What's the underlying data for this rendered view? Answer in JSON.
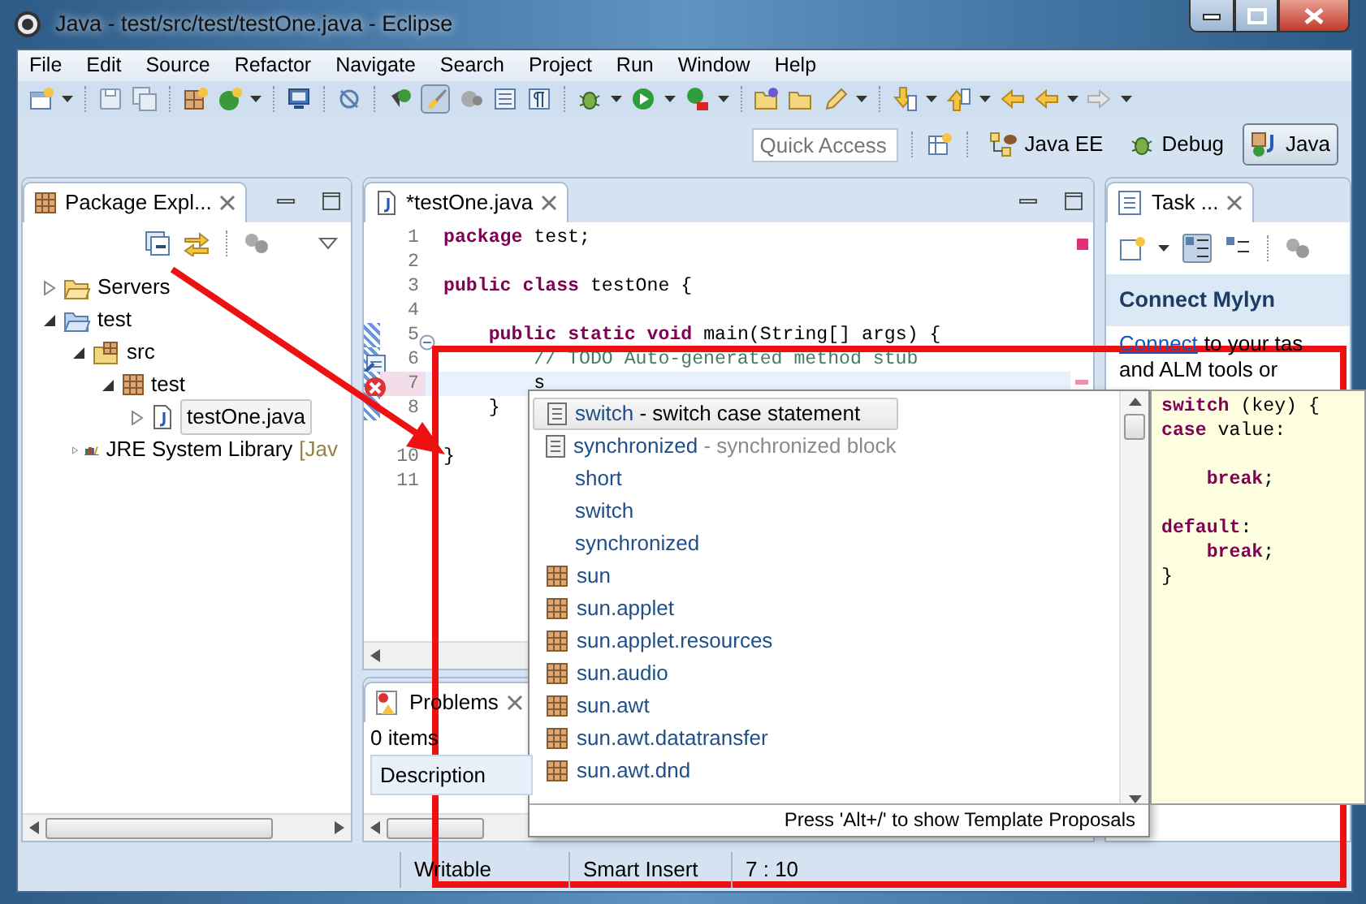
{
  "window": {
    "title": "Java - test/src/test/testOne.java - Eclipse"
  },
  "menu": [
    "File",
    "Edit",
    "Source",
    "Refactor",
    "Navigate",
    "Search",
    "Project",
    "Run",
    "Window",
    "Help"
  ],
  "toolbar": {
    "highlight_toggle": {
      "pressed": true
    }
  },
  "quick_access": {
    "placeholder": "Quick Access"
  },
  "perspectives": [
    {
      "label": "Java EE",
      "selected": false
    },
    {
      "label": "Debug",
      "selected": false
    },
    {
      "label": "Java",
      "selected": true
    }
  ],
  "package_explorer": {
    "tab": "Package Expl...",
    "tree": [
      {
        "label": "Servers",
        "kind": "folder",
        "expanded": false,
        "selected": false
      },
      {
        "label": "test",
        "kind": "project",
        "expanded": true,
        "selected": false,
        "children": [
          {
            "label": "src",
            "kind": "source",
            "expanded": true,
            "selected": false,
            "children": [
              {
                "label": "test",
                "kind": "package",
                "expanded": true,
                "selected": false,
                "children": [
                  {
                    "label": "testOne.java",
                    "kind": "java",
                    "expanded": false,
                    "selected": true
                  }
                ]
              }
            ]
          },
          {
            "label": "JRE System Library",
            "decoration": "[Jav",
            "kind": "library",
            "expanded": false,
            "selected": false
          }
        ]
      }
    ]
  },
  "editor": {
    "tab": "*testOne.java",
    "lines": [
      {
        "number": "1",
        "text": "**package** test;"
      },
      {
        "number": "2"
      },
      {
        "number": "3",
        "text": "**public** **class** testOne {"
      },
      {
        "number": "4"
      },
      {
        "number": "5",
        "text": "    **public** **static** **void** main(String[] args) {",
        "foldable": true,
        "changed": true
      },
      {
        "number": "6",
        "text": "        // TODO Auto-generated method stub",
        "kind": "comment",
        "task_marker": true,
        "changed": true
      },
      {
        "number": "7",
        "text": "        s",
        "error": true,
        "current": true,
        "changed": true
      },
      {
        "number": "8",
        "text": "    }",
        "changed": true
      },
      {
        "number": "10",
        "text": "}",
        "gap_before": true
      },
      {
        "number": "11"
      }
    ]
  },
  "completion": {
    "items": [
      {
        "kind": "template",
        "label": "switch",
        "detail": "- switch case statement",
        "selected": true
      },
      {
        "kind": "template",
        "label": "synchronized",
        "detail": "- synchronized block",
        "selected": false
      },
      {
        "kind": "keyword",
        "label": "short",
        "selected": false
      },
      {
        "kind": "keyword",
        "label": "switch",
        "selected": false
      },
      {
        "kind": "keyword",
        "label": "synchronized",
        "selected": false
      },
      {
        "kind": "package",
        "label": "sun",
        "selected": false
      },
      {
        "kind": "package",
        "label": "sun.applet",
        "selected": false
      },
      {
        "kind": "package",
        "label": "sun.applet.resources",
        "selected": false
      },
      {
        "kind": "package",
        "label": "sun.audio",
        "selected": false
      },
      {
        "kind": "package",
        "label": "sun.awt",
        "selected": false
      },
      {
        "kind": "package",
        "label": "sun.awt.datatransfer",
        "selected": false
      },
      {
        "kind": "package",
        "label": "sun.awt.dnd",
        "selected": false
      }
    ],
    "footer": "Press 'Alt+/' to show Template Proposals",
    "info_lines": [
      {
        "text": "**switch** (key) {"
      },
      {
        "text": "**case** value:"
      },
      {
        "text": "    **break**;",
        "gap_before": true
      },
      {
        "text": "**default**:",
        "gap_before": true
      },
      {
        "text": "    **break**;"
      },
      {
        "text": "}"
      }
    ]
  },
  "task_panel": {
    "tab": "Task ...",
    "heading": "Connect Mylyn",
    "link": "Connect",
    "text_1": "to your tas",
    "text_2": "and ALM tools or"
  },
  "problems": {
    "tab": "Problems",
    "count": "0 items",
    "column": "Description"
  },
  "status_bar": [
    "Writable",
    "Smart Insert",
    "7 : 10"
  ]
}
